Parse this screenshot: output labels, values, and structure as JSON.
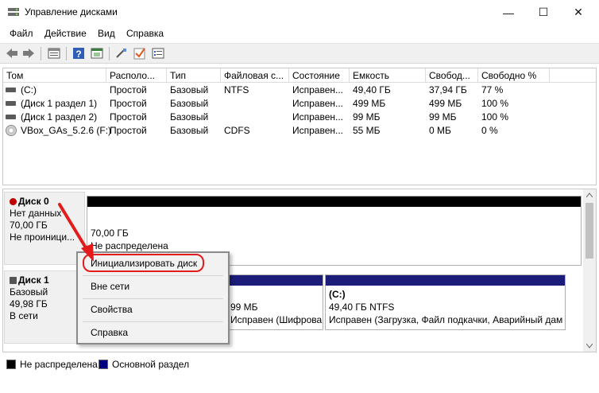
{
  "window": {
    "title": "Управление дисками",
    "minimize": "—",
    "maximize": "☐",
    "close": "✕"
  },
  "menu": [
    "Файл",
    "Действие",
    "Вид",
    "Справка"
  ],
  "toolbar": [
    "back-icon",
    "forward-icon",
    "properties-icon",
    "help-icon",
    "window-icon",
    "wizard-icon",
    "check-icon",
    "list-icon"
  ],
  "volumes": {
    "columns": [
      "Том",
      "Располо...",
      "Тип",
      "Файловая с...",
      "Состояние",
      "Емкость",
      "Свобод...",
      "Свободно %"
    ],
    "rows": [
      {
        "name": "(C:)",
        "layout": "Простой",
        "type": "Базовый",
        "fs": "NTFS",
        "status": "Исправен...",
        "capacity": "49,40 ГБ",
        "free": "37,94 ГБ",
        "pct": "77 %"
      },
      {
        "name": "(Диск 1 раздел 1)",
        "layout": "Простой",
        "type": "Базовый",
        "fs": "",
        "status": "Исправен...",
        "capacity": "499 МБ",
        "free": "499 МБ",
        "pct": "100 %"
      },
      {
        "name": "(Диск 1 раздел 2)",
        "layout": "Простой",
        "type": "Базовый",
        "fs": "",
        "status": "Исправен...",
        "capacity": "99 МБ",
        "free": "99 МБ",
        "pct": "100 %"
      },
      {
        "name": "VBox_GAs_5.2.6 (F:)",
        "layout": "Простой",
        "type": "Базовый",
        "fs": "CDFS",
        "status": "Исправен...",
        "capacity": "55 МБ",
        "free": "0 МБ",
        "pct": "0 %"
      }
    ]
  },
  "disk0": {
    "title": "Диск 0",
    "line1": "Нет данных",
    "line2": "70,00 ГБ",
    "line3": "Не проиници...",
    "part_size": "70,00 ГБ",
    "part_status": "Не распределена"
  },
  "disk1": {
    "title": "Диск 1",
    "line1": "Базовый",
    "line2": "49,98 ГБ",
    "line3": "В сети",
    "p2_size": "99 МБ",
    "p2_status": "Исправен (Шифрова",
    "p3_name": "(C:)",
    "p3_size": "49,40 ГБ NTFS",
    "p3_status": "Исправен (Загрузка, Файл подкачки, Аварийный дам"
  },
  "legend": {
    "unallocated": "Не распределена",
    "primary": "Основной раздел",
    "unallocated_color": "#000000",
    "primary_color": "#00007f"
  },
  "context_menu": {
    "items": [
      "Инициализировать диск",
      "Вне сети",
      "Свойства",
      "Справка"
    ]
  },
  "colors": {
    "accent_red": "#e31b1b",
    "primary_partition": "#1c1c7a"
  }
}
